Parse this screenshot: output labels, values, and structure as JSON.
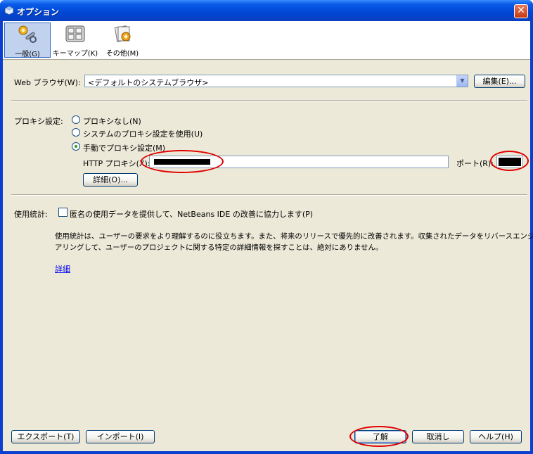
{
  "window": {
    "title": "オプション",
    "close_glyph": "✕"
  },
  "toolbar": {
    "items": [
      {
        "label": "一般(G)",
        "icon": "wrench-gear-icon",
        "selected": true
      },
      {
        "label": "キーマップ(K)",
        "icon": "keyboard-icon",
        "selected": false
      },
      {
        "label": "その他(M)",
        "icon": "misc-gear-icon",
        "selected": false
      }
    ]
  },
  "browser": {
    "label": "Web ブラウザ(W):",
    "selected": "<デフォルトのシステムブラウザ>",
    "edit_button": "編集(E)..."
  },
  "proxy": {
    "label": "プロキシ設定:",
    "options": [
      {
        "label": "プロキシなし(N)",
        "checked": false
      },
      {
        "label": "システムのプロキシ設定を使用(U)",
        "checked": false
      },
      {
        "label": "手動でプロキシ設定(M)",
        "checked": true
      }
    ],
    "http_label": "HTTP プロキシ(X):",
    "port_label": "ポート(R):",
    "details_button": "詳細(O)..."
  },
  "usage": {
    "label": "使用統計:",
    "checkbox_label": "匿名の使用データを提供して、NetBeans IDE の改善に協力します(P)",
    "checked": false,
    "description_line1": "使用統計は、ユーザーの要求をより理解するのに役立ちます。また、将来のリリースで優先的に改善されます。収集されたデータをリバースエンジニ",
    "description_line2": "アリングして、ユーザーのプロジェクトに関する特定の詳細情報を探すことは、絶対にありません。",
    "details_link": "詳細"
  },
  "footer": {
    "export_button": "エクスポート(T)",
    "import_button": "インポート(I)",
    "ok_button": "了解",
    "cancel_button": "取消し",
    "help_button": "ヘルプ(H)"
  },
  "colors": {
    "titlebar": "#0a5ae8",
    "dialog_bg": "#ece9d8",
    "annotation_red": "#e00000",
    "link": "#0000ee"
  }
}
